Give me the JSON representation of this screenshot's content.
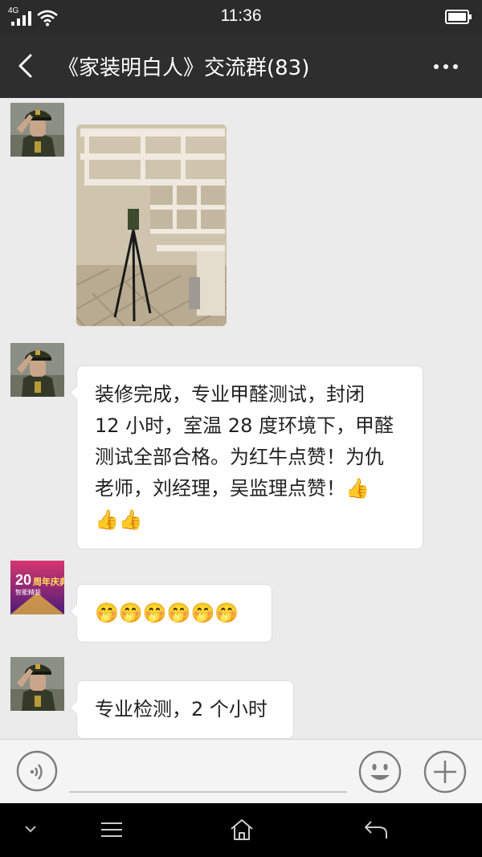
{
  "status_bar": {
    "network": "4G",
    "time": "11:36"
  },
  "header": {
    "title": "《家装明白人》交流群(83)"
  },
  "messages": [
    {
      "type": "image",
      "sender_avatar": "soldier-avatar"
    },
    {
      "type": "text",
      "sender_avatar": "soldier-avatar",
      "lines": [
        "装修完成，专业甲醛测试，封闭",
        "12 小时，室温 28 度环境下，甲醛",
        "测试全部合格。为红牛点赞！为仇",
        "老师，刘经理，吴监理点赞！👍",
        "👍👍"
      ]
    },
    {
      "type": "text",
      "sender_avatar": "anniversary-avatar",
      "avatar_text": {
        "top": "20",
        "mid": "周年庆典",
        "sub": "智能精装"
      },
      "lines": [
        "🤭🤭🤭🤭🤭🤭"
      ]
    },
    {
      "type": "text",
      "sender_avatar": "soldier-avatar",
      "lines": [
        "专业检测，2 个小时"
      ]
    }
  ],
  "colors": {
    "status_bar_bg": "#2b2b2b",
    "title_bar_bg": "#2e2e2e",
    "chat_bg": "#ebebeb",
    "bubble_bg": "#ffffff"
  }
}
